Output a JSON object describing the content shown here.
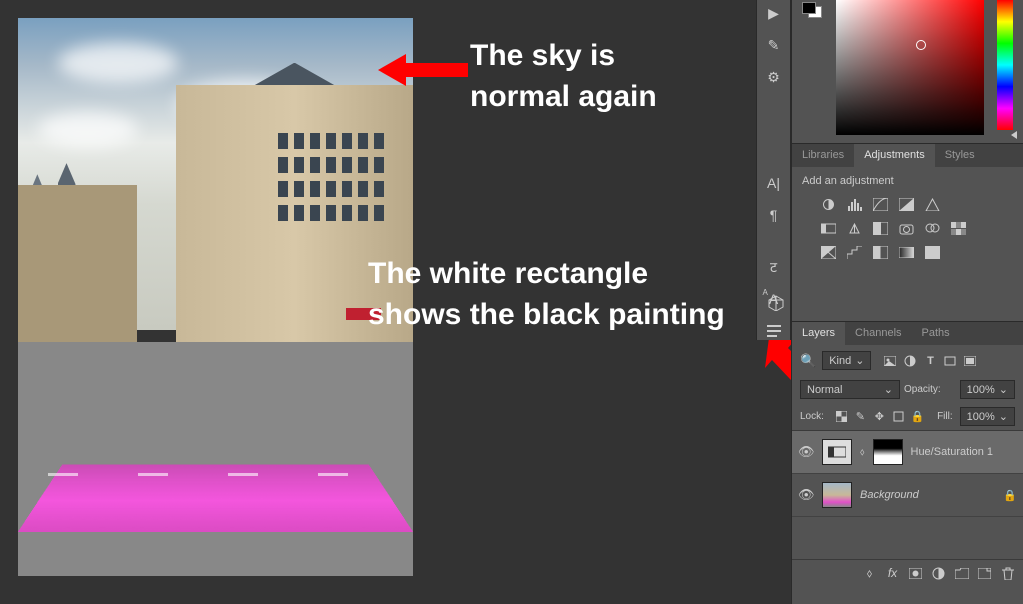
{
  "annotations": {
    "sky": "The sky is\nnormal again",
    "rect": "The white rectangle\nshows the black painting"
  },
  "panels": {
    "adjustments": {
      "tabs": [
        "Libraries",
        "Adjustments",
        "Styles"
      ],
      "active_tab": "Adjustments",
      "heading": "Add an adjustment"
    },
    "layers": {
      "tabs": [
        "Layers",
        "Channels",
        "Paths"
      ],
      "active_tab": "Layers",
      "filter_label": "Kind",
      "blend_mode": "Normal",
      "opacity_label": "Opacity:",
      "opacity_value": "100%",
      "lock_label": "Lock:",
      "fill_label": "Fill:",
      "fill_value": "100%",
      "items": [
        {
          "name": "Hue/Saturation 1",
          "type": "adjustment",
          "visible": true,
          "selected": true
        },
        {
          "name": "Background",
          "type": "image",
          "visible": true,
          "locked": true
        }
      ]
    }
  },
  "icons": {
    "play": "▶",
    "brush": "✎",
    "sliders": "⚙",
    "char_a": "A|",
    "paragraph": "¶",
    "glyph": "ट",
    "a_text": "A"
  }
}
